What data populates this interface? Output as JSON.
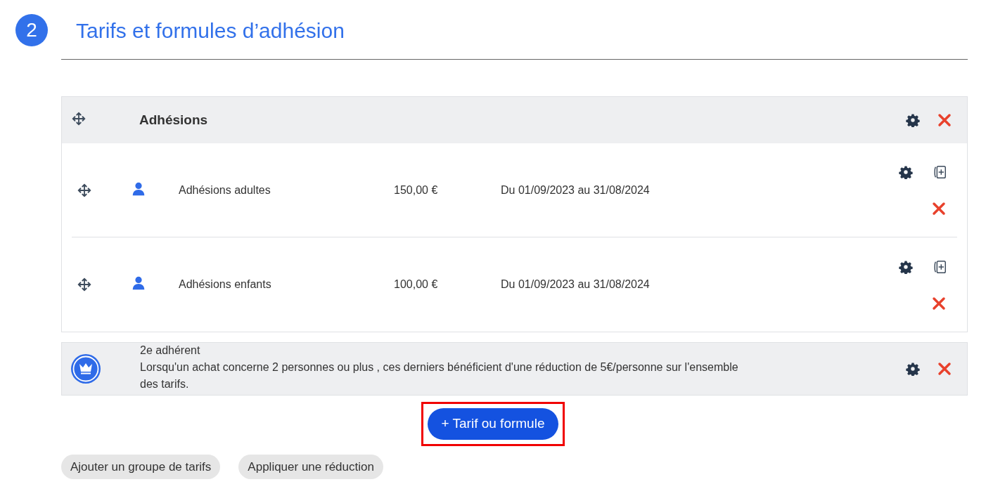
{
  "section": {
    "step": "2",
    "title": "Tarifs et formules d’adhésion"
  },
  "group": {
    "title": "Adhésions",
    "rows": [
      {
        "name": "Adhésions adultes",
        "price": "150,00 €",
        "period": "Du 01/09/2023 au 31/08/2024"
      },
      {
        "name": "Adhésions enfants",
        "price": "100,00 €",
        "period": "Du 01/09/2023 au 31/08/2024"
      }
    ]
  },
  "discount": {
    "title": "2e adhérent",
    "description": "Lorsqu'un achat concerne 2 personnes ou plus , ces derniers bénéficient d'une réduction de 5€/personne sur l'ensemble des tarifs."
  },
  "add_button": {
    "label": "+ Tarif ou formule",
    "highlighted": true
  },
  "secondary_buttons": [
    "Ajouter un groupe de tarifs",
    "Appliquer une réduction"
  ]
}
